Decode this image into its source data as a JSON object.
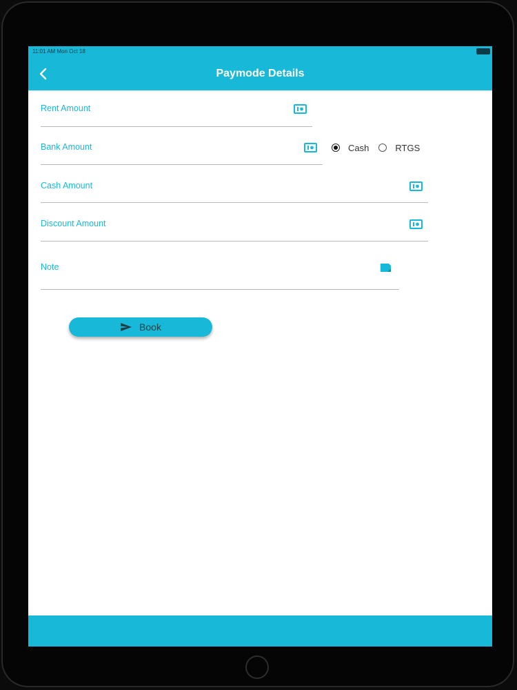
{
  "status_bar": {
    "time": "11:01 AM   Mon Oct 18"
  },
  "app_bar": {
    "title": "Paymode Details",
    "back_icon": "chevron-left-icon"
  },
  "form": {
    "fields": [
      {
        "label": "Rent Amount",
        "icon": "money-icon"
      },
      {
        "label": "Bank Amount",
        "icon": "money-icon"
      },
      {
        "label": "Cash Amount",
        "icon": "money-icon"
      },
      {
        "label": "Discount Amount",
        "icon": "money-icon"
      },
      {
        "label": "Note",
        "icon": "note-icon"
      }
    ],
    "payment_mode": {
      "options": [
        "Cash",
        "RTGS"
      ],
      "selected": "Cash"
    },
    "book_button": {
      "label": "Book",
      "icon": "send-icon"
    }
  },
  "colors": {
    "accent": "#18b9d8",
    "background": "#ffffff",
    "device": "#050505"
  }
}
